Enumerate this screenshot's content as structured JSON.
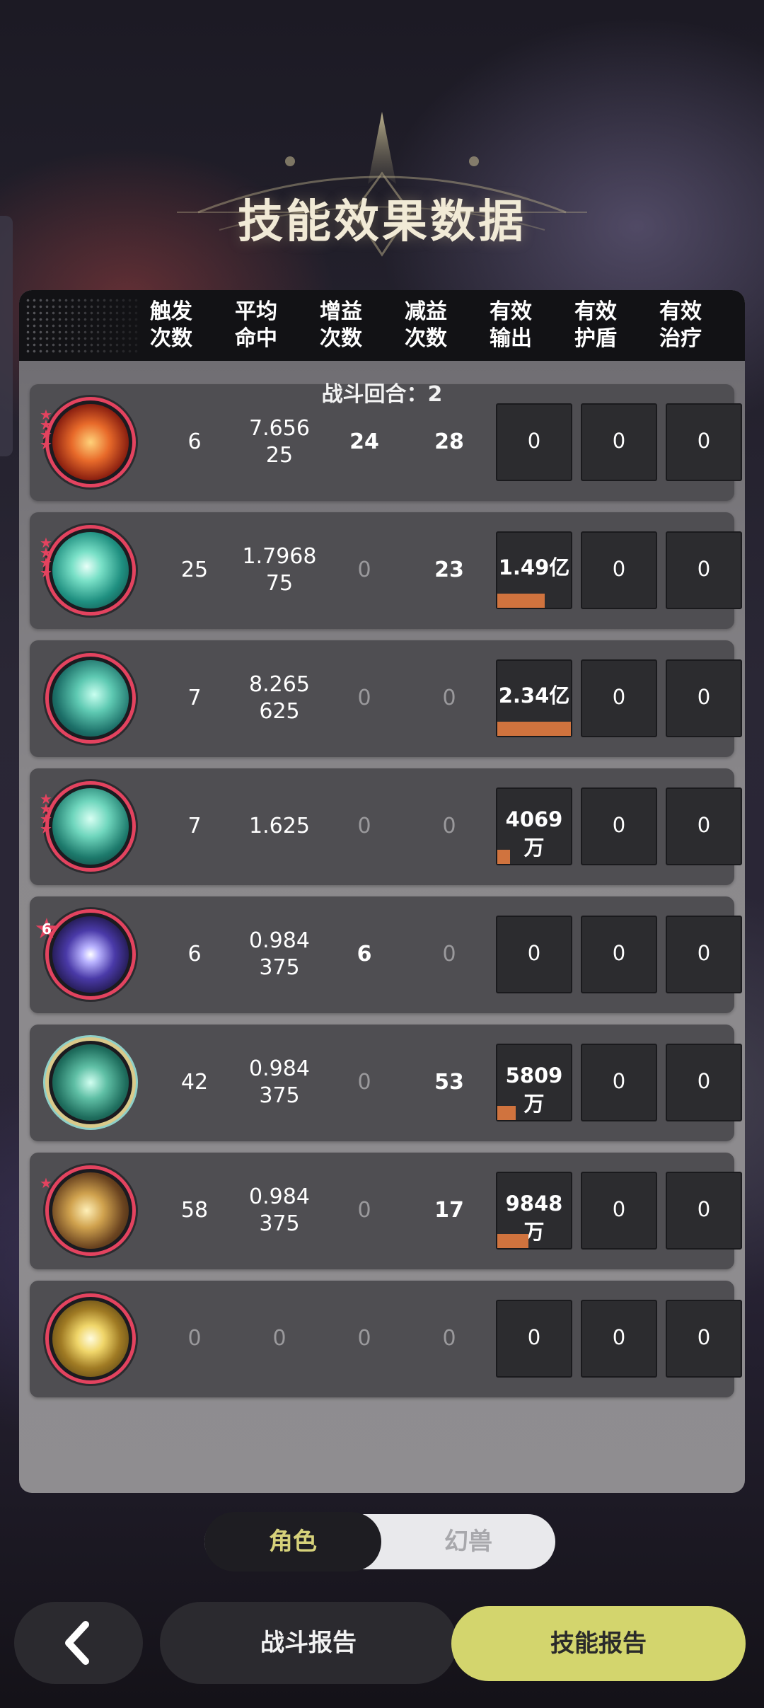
{
  "title": "技能效果数据",
  "headers": [
    "触发\n次数",
    "平均\n命中",
    "增益\n次数",
    "减益\n次数",
    "有效\n输出",
    "有效\n护盾",
    "有效\n治疗"
  ],
  "round_label": "战斗回合：2",
  "rows": [
    {
      "icon": "explosion-skill-icon",
      "stars": 4,
      "trigger": "6",
      "avg": "7.656\n25",
      "buff": "24",
      "debuff": "28",
      "output": "0",
      "output_level": 0,
      "shield": "0",
      "heal": "0"
    },
    {
      "icon": "vortex-skill-icon",
      "stars": 4,
      "trigger": "25",
      "avg": "1.7968\n75",
      "buff": "0",
      "debuff": "23",
      "output": "1.49亿",
      "output_level": 0.64,
      "shield": "0",
      "heal": "0"
    },
    {
      "icon": "wind-skill-icon",
      "stars": 0,
      "trigger": "7",
      "avg": "8.265\n625",
      "buff": "0",
      "debuff": "0",
      "output": "2.34亿",
      "output_level": 1.0,
      "shield": "0",
      "heal": "0"
    },
    {
      "icon": "wave-skill-icon",
      "stars": 4,
      "trigger": "7",
      "avg": "1.625",
      "buff": "0",
      "debuff": "0",
      "output": "4069万",
      "output_level": 0.17,
      "shield": "0",
      "heal": "0"
    },
    {
      "icon": "clock-skill-icon",
      "level_badge": "6",
      "trigger": "6",
      "avg": "0.984\n375",
      "buff": "6",
      "debuff": "0",
      "output": "0",
      "output_level": 0,
      "shield": "0",
      "heal": "0"
    },
    {
      "icon": "crystal-skill-icon",
      "stars": 0,
      "trigger": "42",
      "avg": "0.984\n375",
      "buff": "0",
      "debuff": "53",
      "output": "5809万",
      "output_level": 0.25,
      "shield": "0",
      "heal": "0"
    },
    {
      "icon": "strike-skill-icon",
      "stars": 1,
      "trigger": "58",
      "avg": "0.984\n375",
      "buff": "0",
      "debuff": "17",
      "output": "9848万",
      "output_level": 0.42,
      "shield": "0",
      "heal": "0"
    },
    {
      "icon": "light-skill-icon",
      "stars": 0,
      "trigger": "0",
      "avg": "0",
      "buff": "0",
      "debuff": "0",
      "output": "0",
      "output_level": 0,
      "shield": "0",
      "heal": "0"
    }
  ],
  "toggle": {
    "active": "角色",
    "inactive": "幻兽"
  },
  "buttons": {
    "back_icon": "chevron-left-icon",
    "battle_report": "战斗报告",
    "skill_report": "技能报告"
  },
  "colors": {
    "accent": "#d3d56d",
    "bar": "#d0733e",
    "ring": "#e3435f"
  }
}
